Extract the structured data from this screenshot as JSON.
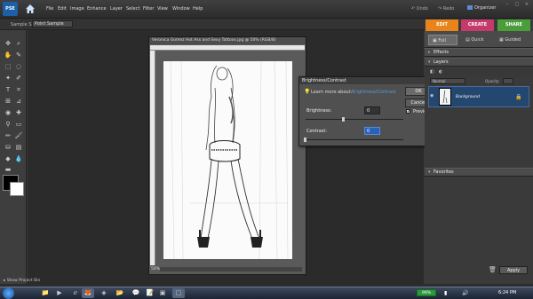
{
  "app": {
    "logo_text": "PSE",
    "menu": [
      "File",
      "Edit",
      "Image",
      "Enhance",
      "Layer",
      "Select",
      "Filter",
      "View",
      "Window",
      "Help"
    ],
    "undo": "Undo",
    "redo": "Redo",
    "organizer": "Organizer"
  },
  "options_bar": {
    "sample_size_label": "Sample Size:",
    "sample_size_value": "Point Sample"
  },
  "mode_tabs": [
    "EDIT",
    "CREATE",
    "SHARE"
  ],
  "subtabs": [
    "Full",
    "Quick",
    "Guided"
  ],
  "document": {
    "title": "Veronica Gomez  Hot Ass and Sexy Tattoos.jpg @ 50% (RGB/8)",
    "zoom": "50%"
  },
  "dialog": {
    "title": "Brightness/Contrast",
    "tip": "Learn more about:",
    "tip_link": "Brightness/Contrast",
    "ok": "OK",
    "cancel": "Cancel",
    "preview_label": "Preview",
    "preview_checked": "✓",
    "brightness_label": "Brightness:",
    "brightness_value": "0",
    "contrast_label": "Contrast:",
    "contrast_value": "0"
  },
  "panels": {
    "effects": "Effects",
    "layers": "Layers",
    "blend_mode": "Normal",
    "opacity_label": "Opacity:",
    "layer_name": "Background",
    "favorites": "Favorites",
    "apply": "Apply"
  },
  "project_bin": "Show Project Bin",
  "taskbar": {
    "battery": "99%",
    "clock": "6:24 PM"
  }
}
